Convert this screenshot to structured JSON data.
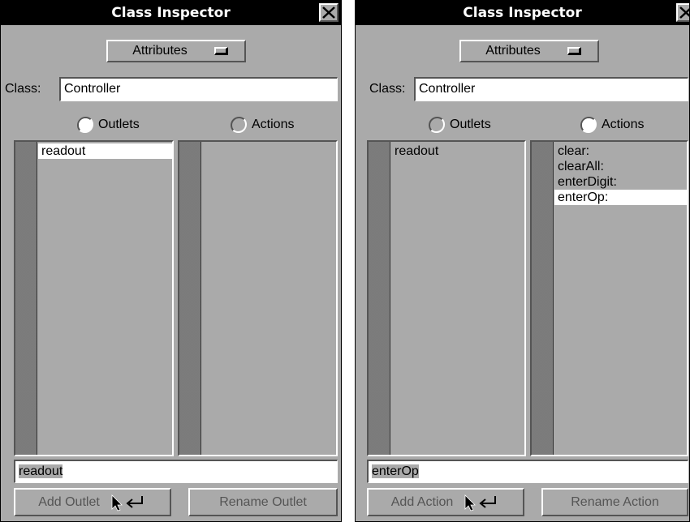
{
  "panels": [
    {
      "title": "Class Inspector",
      "popup_label": "Attributes",
      "class_label": "Class:",
      "class_value": "Controller",
      "radio_outlets": "Outlets",
      "radio_actions": "Actions",
      "selected_radio": "outlets",
      "outlets": [
        "readout"
      ],
      "actions": [],
      "field_value": "readout",
      "add_button": "Add Outlet",
      "rename_button": "Rename Outlet"
    },
    {
      "title": "Class Inspector",
      "popup_label": "Attributes",
      "class_label": "Class:",
      "class_value": "Controller",
      "radio_outlets": "Outlets",
      "radio_actions": "Actions",
      "selected_radio": "actions",
      "outlets": [
        "readout"
      ],
      "actions": [
        "clear:",
        "clearAll:",
        "enterDigit:",
        "enterOp:"
      ],
      "field_value": "enterOp",
      "add_button": "Add Action",
      "rename_button": "Rename Action"
    }
  ],
  "icons": {
    "close": "close-icon",
    "popup": "popup-menu-icon",
    "radio": "radio-icon",
    "return": "return-key-icon",
    "cursor": "arrow-cursor-icon"
  }
}
